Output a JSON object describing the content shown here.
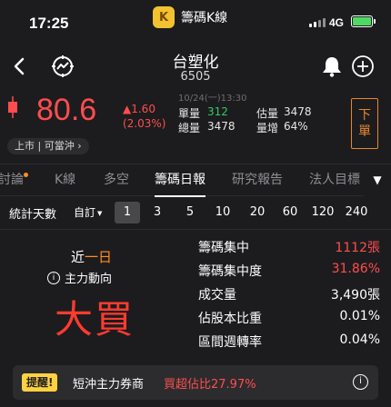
{
  "status_bar": {
    "time": "17:25",
    "app_name": "籌碼K線",
    "app_logo_text": "K",
    "network": "4G"
  },
  "nav": {
    "back_glyph": "‹",
    "stock_name": "台塑化",
    "stock_code": "6505"
  },
  "quote": {
    "price": "80.6",
    "change": "▲1.60",
    "change_pct": "(2.03%)",
    "timestamp": "10/24(一)13:30",
    "single_volume_label": "單量",
    "single_volume": "312",
    "total_volume_label": "總量",
    "total_volume": "3478",
    "est_volume_label": "估量",
    "est_volume": "3478",
    "volume_increase_label": "量增",
    "volume_increase": "64%",
    "trade_button_top": "下",
    "trade_button_bottom": "單",
    "market_tag": "上市 | 可當沖 ›"
  },
  "tabs": [
    {
      "label": "討論"
    },
    {
      "label": "K線"
    },
    {
      "label": "多空"
    },
    {
      "label": "籌碼日報"
    },
    {
      "label": "研究報告"
    },
    {
      "label": "法人目標"
    }
  ],
  "tab_more_glyph": "▼",
  "period": {
    "label": "統計天數",
    "custom_label": "自訂",
    "custom_caret": "▼",
    "options": [
      "1",
      "3",
      "5",
      "10",
      "20",
      "60",
      "120",
      "240"
    ],
    "selected": "1"
  },
  "summary": {
    "near_prefix": "近",
    "near_days": "一日",
    "main_force_label": "主力動向",
    "info_glyph": "i",
    "verdict": "大買"
  },
  "metrics": [
    {
      "label": "籌碼集中",
      "value": "1112張"
    },
    {
      "label": "籌碼集中度",
      "value": "31.86%"
    },
    {
      "label": "成交量",
      "value": "3,490張"
    },
    {
      "label": "佔股本比重",
      "value": "0.01%"
    },
    {
      "label": "區間週轉率",
      "value": "0.04%"
    }
  ],
  "alert": {
    "badge": "提醒!",
    "text": "短沖主力券商",
    "highlight": "買超佔比27.97%",
    "info_glyph": "i"
  },
  "colors": {
    "up_red": "#ff4d4f",
    "green": "#33cc66",
    "orange": "#ff8c28",
    "background": "#1c1c1e"
  }
}
